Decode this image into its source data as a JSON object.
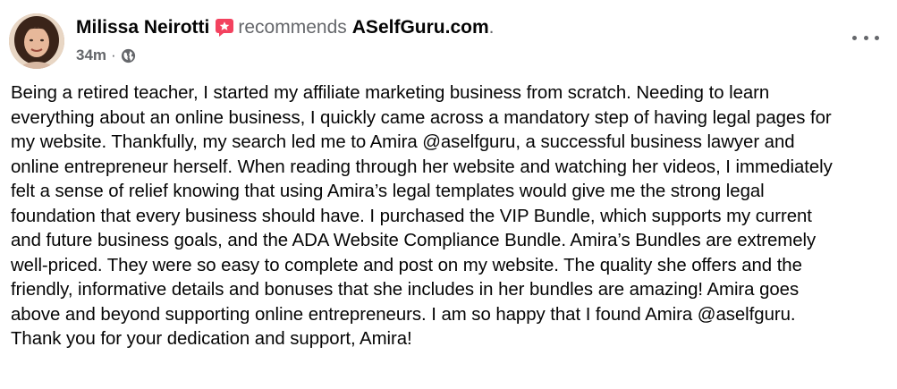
{
  "post": {
    "author": "Milissa Neirotti",
    "action": "recommends",
    "page": "ASelfGuru.com",
    "period": ".",
    "time": "34m",
    "separator": "·",
    "privacy_icon": "globe-icon",
    "recommend_icon": "recommend-flag-icon",
    "more_icon": "more-options-icon",
    "body_lines": [
      "Being a retired teacher, I started my affiliate marketing business from scratch. Needing to learn",
      "everything about an online business, I quickly came across a mandatory step of having legal pages for",
      "my website. Thankfully, my search led me to Amira @aselfguru, a successful business lawyer and",
      "online entrepreneur herself. When reading through her website and watching her videos, I immediately",
      "felt a sense of relief knowing that using Amira’s legal templates would give me the strong legal",
      "foundation that every business should have. I purchased the VIP Bundle, which supports my current",
      "and future business goals, and the ADA Website Compliance Bundle.  Amira’s Bundles are extremely",
      "well-priced. They were so easy to complete and post on my website. The quality she offers and the",
      "friendly, informative details and bonuses that she includes in her bundles are amazing! Amira goes",
      "above and beyond supporting online entrepreneurs. I am so happy that I found Amira @aselfguru.",
      "Thank you for your dedication and support, Amira!"
    ]
  },
  "colors": {
    "text_primary": "#050505",
    "text_secondary": "#65676b",
    "recommend_pink": "#f3425f",
    "background": "#ffffff"
  }
}
